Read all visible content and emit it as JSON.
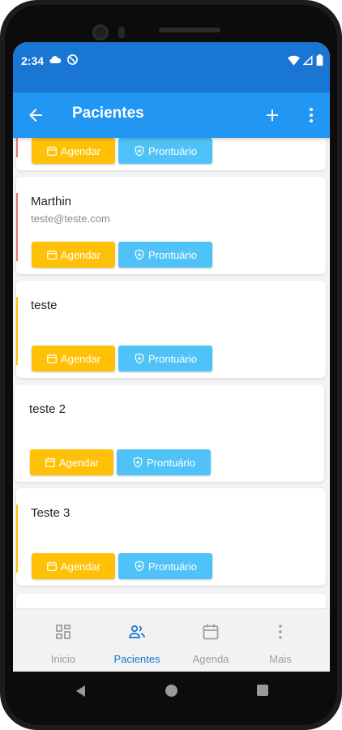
{
  "status_bar": {
    "time": "2:34"
  },
  "app_bar": {
    "title": "Pacientes",
    "back_icon": "arrow-back-icon",
    "add_icon": "plus-icon",
    "more_icon": "more-vertical-icon"
  },
  "patients": [
    {
      "name": "",
      "email": "",
      "accent": "#e57373",
      "agendar_label": "Agendar",
      "prontuario_label": "Prontuário"
    },
    {
      "name": "Marthin",
      "email": "teste@teste.com",
      "accent": "#e57373",
      "agendar_label": "Agendar",
      "prontuario_label": "Prontuário"
    },
    {
      "name": "teste",
      "email": "",
      "accent": "#ffc107",
      "agendar_label": "Agendar",
      "prontuario_label": "Prontuário"
    },
    {
      "name": "teste 2",
      "email": "",
      "accent": "",
      "agendar_label": "Agendar",
      "prontuario_label": "Prontuário"
    },
    {
      "name": "Teste 3",
      "email": "",
      "accent": "#ffc107",
      "agendar_label": "Agendar",
      "prontuario_label": "Prontuário"
    }
  ],
  "bottom_nav": {
    "items": [
      {
        "label": "Inicio",
        "icon": "dashboard-icon",
        "active": false
      },
      {
        "label": "Pacientes",
        "icon": "people-icon",
        "active": true
      },
      {
        "label": "Agenda",
        "icon": "calendar-icon",
        "active": false
      },
      {
        "label": "Mais",
        "icon": "more-vertical-icon",
        "active": false
      }
    ]
  },
  "colors": {
    "primary": "#2196f3",
    "primary_dark": "#1976d2",
    "agendar": "#ffc107",
    "prontuario": "#4fc3f7",
    "inactive": "#9e9e9e"
  }
}
